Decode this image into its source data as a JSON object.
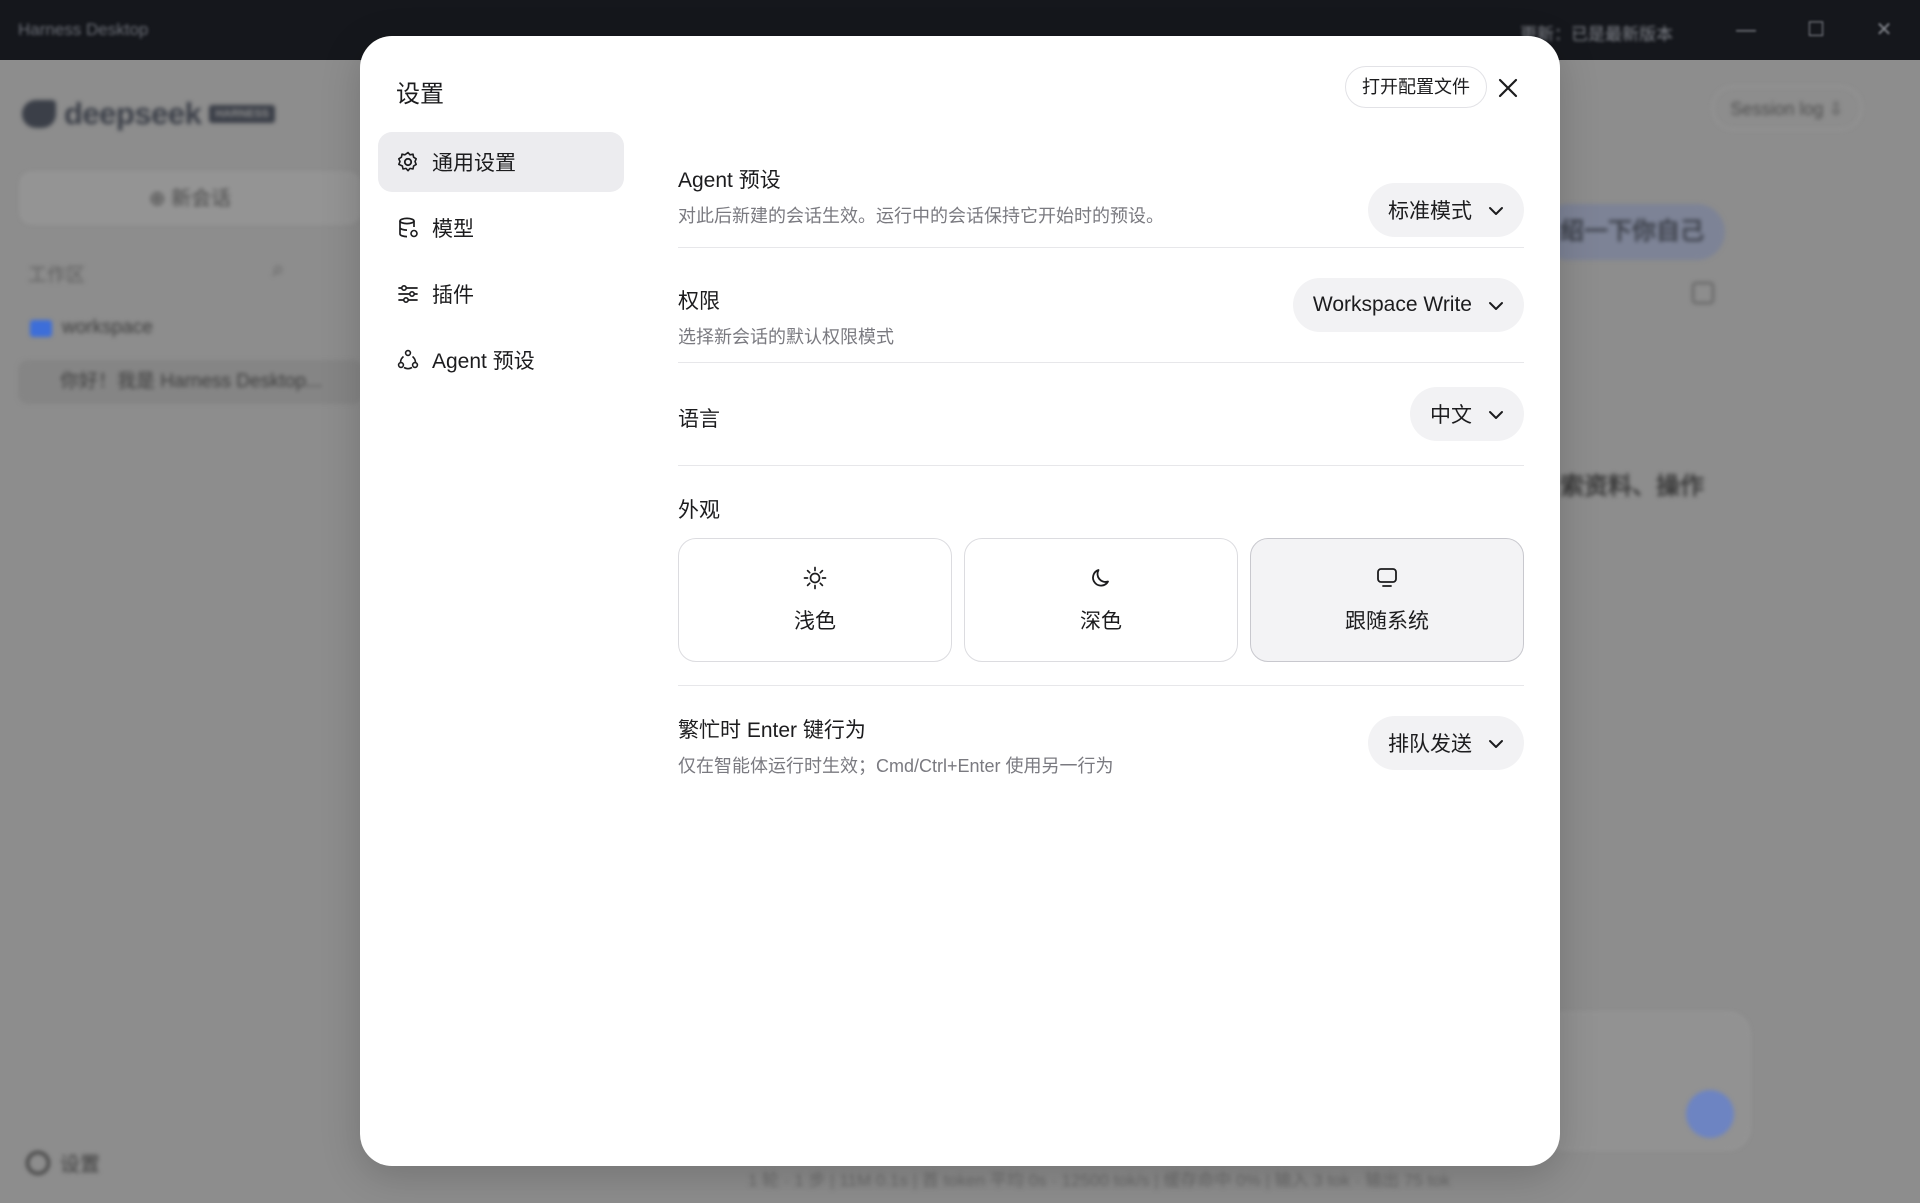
{
  "background": {
    "window_title": "Harness Desktop",
    "update_notice": "更新：已是最新版本",
    "window_controls": [
      "—",
      "☐",
      "✕"
    ],
    "brand_word": "deepseek",
    "brand_tag": "HARNESS",
    "new_chat_label": "⊕ 新会话",
    "workspace_section_label": "工作区",
    "workspace_folder": "workspace",
    "session_item": "你好！我是 Harness Desktop...",
    "settings_label": "设置",
    "session_log_button": "Session log ⇩",
    "user_bubble_text": "绍一下你自己",
    "assistant_snippet": "索资料、操作",
    "status_bar": "1 轮 · 1 步  |  11M 0.1s  |  首 token 平均 0s · 12500 tok/s  |  缓存命中 0%  |  输入 3 tok · 输出 75 tok"
  },
  "modal": {
    "title": "设置",
    "open_config_label": "打开配置文件",
    "nav": [
      {
        "label": "通用设置",
        "icon": "gear-icon",
        "active": true
      },
      {
        "label": "模型",
        "icon": "database-icon",
        "active": false
      },
      {
        "label": "插件",
        "icon": "sliders-icon",
        "active": false
      },
      {
        "label": "Agent 预设",
        "icon": "agent-nodes-icon",
        "active": false
      }
    ],
    "agent_preset": {
      "label": "Agent 预设",
      "description": "对此后新建的会话生效。运行中的会话保持它开始时的预设。",
      "value": "标准模式"
    },
    "permissions": {
      "label": "权限",
      "description": "选择新会话的默认权限模式",
      "value": "Workspace Write"
    },
    "language": {
      "label": "语言",
      "value": "中文"
    },
    "appearance": {
      "label": "外观",
      "options": [
        {
          "label": "浅色",
          "icon": "sun-icon",
          "selected": false
        },
        {
          "label": "深色",
          "icon": "moon-icon",
          "selected": false
        },
        {
          "label": "跟随系统",
          "icon": "monitor-icon",
          "selected": true
        }
      ]
    },
    "busy_enter": {
      "label": "繁忙时 Enter 键行为",
      "description": "仅在智能体运行时生效；Cmd/Ctrl+Enter 使用另一行为",
      "value": "排队发送"
    }
  },
  "colors": {
    "overlay_gray": "#8e8e8e",
    "active_nav_bg": "#ececef",
    "select_bg": "#f2f2f4",
    "selected_card_bg": "#f3f3f5",
    "description_text": "#7a7a80"
  }
}
